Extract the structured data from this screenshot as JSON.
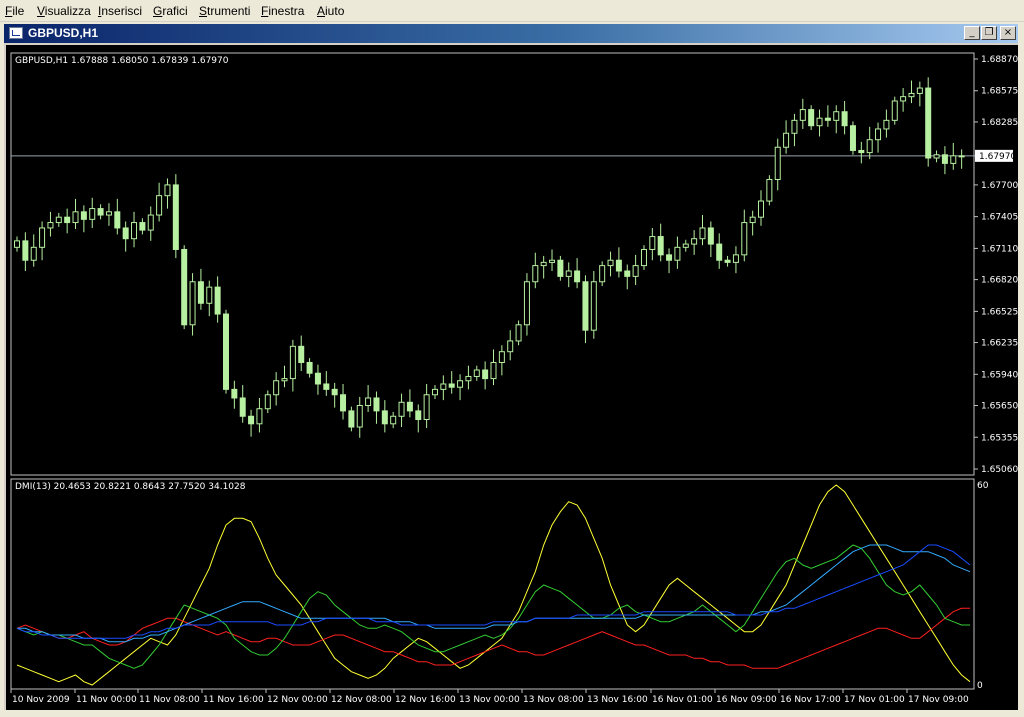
{
  "menu": [
    {
      "label": "File",
      "underline": 0
    },
    {
      "label": "Visualizza",
      "underline": 0
    },
    {
      "label": "Inserisci",
      "underline": 0
    },
    {
      "label": "Grafici",
      "underline": 0
    },
    {
      "label": "Strumenti",
      "underline": 0
    },
    {
      "label": "Finestra",
      "underline": 0
    },
    {
      "label": "Aiuto",
      "underline": 0
    }
  ],
  "window": {
    "title": "GBPUSD,H1",
    "minimize": "_",
    "restore": "❐",
    "close": "×"
  },
  "colors": {
    "background": "#000000",
    "candle": "#b7f0a0",
    "grid": "#c0c0c0",
    "current_line": "#9aa6b0",
    "axis_text": "#ffffff",
    "plus_di": "#33cc33",
    "minus_di": "#ff2020",
    "adx": "#1a4cff",
    "adxr": "#33aaff",
    "extra_line": "#ffff33"
  },
  "chart_data": {
    "type": "candlestick",
    "info": "GBPUSD,H1  1.67888 1.68050 1.67839 1.67970",
    "current_price": "1.67970",
    "price_ticks": [
      "1.68870",
      "1.68575",
      "1.68285",
      "1.67970",
      "1.67700",
      "1.67405",
      "1.67110",
      "1.66820",
      "1.66525",
      "1.66235",
      "1.65940",
      "1.65650",
      "1.65355",
      "1.65060"
    ],
    "price_range": [
      1.6506,
      1.6887
    ],
    "time_labels": [
      "10 Nov 2009",
      "11 Nov 00:00",
      "11 Nov 08:00",
      "11 Nov 16:00",
      "12 Nov 00:00",
      "12 Nov 08:00",
      "12 Nov 16:00",
      "13 Nov 00:00",
      "13 Nov 08:00",
      "13 Nov 16:00",
      "16 Nov 01:00",
      "16 Nov 09:00",
      "16 Nov 17:00",
      "17 Nov 01:00",
      "17 Nov 09:00"
    ],
    "close": [
      1.6718,
      1.67,
      1.6712,
      1.673,
      1.6735,
      1.674,
      1.6735,
      1.6745,
      1.6738,
      1.6748,
      1.6742,
      1.6745,
      1.673,
      1.672,
      1.6735,
      1.6728,
      1.6742,
      1.676,
      1.677,
      1.671,
      1.664,
      1.668,
      1.666,
      1.6675,
      1.665,
      1.658,
      1.6572,
      1.6555,
      1.6548,
      1.6562,
      1.6575,
      1.6588,
      1.659,
      1.662,
      1.6605,
      1.6595,
      1.6585,
      1.658,
      1.6575,
      1.656,
      1.6545,
      1.6565,
      1.6572,
      1.656,
      1.6548,
      1.6555,
      1.6568,
      1.656,
      1.6552,
      1.6575,
      1.658,
      1.6585,
      1.6582,
      1.6588,
      1.6592,
      1.6598,
      1.659,
      1.6605,
      1.6615,
      1.6625,
      1.664,
      1.668,
      1.6695,
      1.6698,
      1.67,
      1.6685,
      1.669,
      1.668,
      1.6635,
      1.668,
      1.6695,
      1.67,
      1.669,
      1.6685,
      1.6695,
      1.671,
      1.6722,
      1.6705,
      1.67,
      1.6712,
      1.6715,
      1.672,
      1.673,
      1.6715,
      1.67,
      1.6698,
      1.6705,
      1.6735,
      1.674,
      1.6755,
      1.6775,
      1.6805,
      1.6818,
      1.683,
      1.684,
      1.6825,
      1.6832,
      1.683,
      1.6838,
      1.6825,
      1.6802,
      1.68,
      1.6812,
      1.6822,
      1.683,
      1.6848,
      1.6852,
      1.6855,
      1.686,
      1.6795,
      1.6798,
      1.679,
      1.6797,
      1.6797
    ],
    "dmi_info": "DMI(13) 20.4653 20.8221 0.8643 27.7520 34.1028",
    "dmi_ticks": [
      "60",
      "0"
    ],
    "dmi_range": [
      0,
      60
    ],
    "plus_di": [
      17,
      16,
      15,
      16,
      15,
      15,
      14,
      13,
      12,
      12,
      10,
      8,
      7,
      6,
      5,
      6,
      9,
      12,
      16,
      20,
      24,
      23,
      22,
      21,
      20,
      18,
      14,
      12,
      10,
      9,
      9,
      11,
      14,
      18,
      22,
      26,
      28,
      27,
      24,
      22,
      20,
      18,
      17,
      17,
      18,
      17,
      16,
      14,
      12,
      11,
      10,
      10,
      11,
      12,
      13,
      14,
      15,
      14,
      15,
      17,
      20,
      24,
      28,
      30,
      29,
      28,
      26,
      24,
      22,
      20,
      20,
      21,
      23,
      24,
      22,
      21,
      20,
      19,
      19,
      20,
      21,
      22,
      24,
      22,
      20,
      18,
      16,
      18,
      22,
      26,
      30,
      34,
      37,
      38,
      36,
      35,
      36,
      37,
      38,
      40,
      42,
      41,
      38,
      34,
      30,
      28,
      27,
      28,
      30,
      27,
      24,
      20,
      19,
      18,
      18
    ],
    "minus_di": [
      17,
      18,
      17,
      16,
      15,
      14,
      14,
      15,
      16,
      14,
      13,
      12,
      12,
      13,
      15,
      17,
      18,
      19,
      20,
      20,
      19,
      18,
      17,
      16,
      15,
      16,
      15,
      14,
      13,
      13,
      14,
      14,
      13,
      12,
      12,
      12,
      13,
      14,
      15,
      15,
      14,
      13,
      12,
      11,
      10,
      10,
      9,
      8,
      7,
      7,
      6,
      6,
      6,
      7,
      8,
      9,
      10,
      11,
      12,
      11,
      10,
      10,
      9,
      9,
      10,
      11,
      12,
      13,
      14,
      15,
      16,
      15,
      14,
      13,
      12,
      12,
      11,
      10,
      9,
      9,
      9,
      8,
      8,
      7,
      7,
      6,
      6,
      6,
      5,
      5,
      5,
      5,
      6,
      7,
      8,
      9,
      10,
      11,
      12,
      13,
      14,
      15,
      16,
      17,
      17,
      16,
      15,
      14,
      14,
      16,
      18,
      20,
      22,
      23,
      23
    ],
    "adx": [
      17,
      16,
      16,
      15,
      15,
      14,
      14,
      14,
      14,
      14,
      14,
      14,
      14,
      14,
      15,
      15,
      16,
      16,
      17,
      17,
      18,
      18,
      18,
      18,
      19,
      19,
      19,
      19,
      19,
      19,
      19,
      18,
      18,
      18,
      18,
      19,
      19,
      20,
      20,
      20,
      20,
      20,
      20,
      19,
      19,
      19,
      18,
      18,
      18,
      18,
      18,
      18,
      18,
      18,
      18,
      18,
      18,
      19,
      19,
      19,
      19,
      19,
      20,
      20,
      20,
      20,
      20,
      21,
      21,
      21,
      21,
      21,
      21,
      21,
      21,
      22,
      22,
      22,
      22,
      22,
      22,
      22,
      22,
      22,
      22,
      22,
      21,
      21,
      21,
      21,
      22,
      22,
      23,
      23,
      24,
      25,
      26,
      27,
      28,
      29,
      30,
      31,
      32,
      33,
      34,
      35,
      36,
      38,
      40,
      42,
      42,
      41,
      40,
      38,
      36
    ],
    "adxr": [
      17,
      17,
      16,
      16,
      15,
      15,
      15,
      15,
      14,
      14,
      14,
      13,
      13,
      13,
      14,
      14,
      15,
      15,
      16,
      17,
      18,
      19,
      20,
      21,
      22,
      23,
      24,
      25,
      25,
      25,
      24,
      23,
      22,
      21,
      20,
      20,
      20,
      20,
      20,
      20,
      20,
      20,
      20,
      20,
      20,
      19,
      19,
      19,
      18,
      18,
      17,
      17,
      17,
      17,
      17,
      17,
      17,
      18,
      18,
      18,
      19,
      19,
      20,
      20,
      20,
      20,
      20,
      20,
      20,
      20,
      20,
      20,
      20,
      20,
      20,
      21,
      21,
      21,
      21,
      21,
      21,
      21,
      21,
      21,
      21,
      21,
      21,
      21,
      21,
      22,
      22,
      23,
      24,
      26,
      28,
      30,
      32,
      34,
      36,
      38,
      40,
      41,
      42,
      42,
      42,
      41,
      40,
      40,
      40,
      40,
      39,
      38,
      36,
      35,
      34
    ],
    "extra": [
      6,
      5,
      4,
      3,
      2,
      1,
      2,
      3,
      1,
      0,
      2,
      4,
      6,
      8,
      10,
      12,
      14,
      13,
      12,
      15,
      20,
      25,
      30,
      35,
      42,
      48,
      50,
      50,
      49,
      44,
      38,
      33,
      30,
      27,
      24,
      20,
      16,
      12,
      8,
      6,
      4,
      3,
      2,
      3,
      5,
      8,
      10,
      12,
      14,
      13,
      11,
      9,
      7,
      5,
      6,
      8,
      10,
      12,
      14,
      18,
      22,
      28,
      34,
      42,
      48,
      52,
      55,
      54,
      50,
      44,
      38,
      30,
      24,
      18,
      16,
      18,
      22,
      26,
      30,
      32,
      30,
      28,
      26,
      24,
      22,
      20,
      18,
      16,
      16,
      18,
      22,
      26,
      30,
      36,
      42,
      48,
      54,
      58,
      60,
      58,
      54,
      50,
      46,
      42,
      38,
      34,
      30,
      26,
      22,
      18,
      14,
      10,
      6,
      3,
      1
    ]
  }
}
